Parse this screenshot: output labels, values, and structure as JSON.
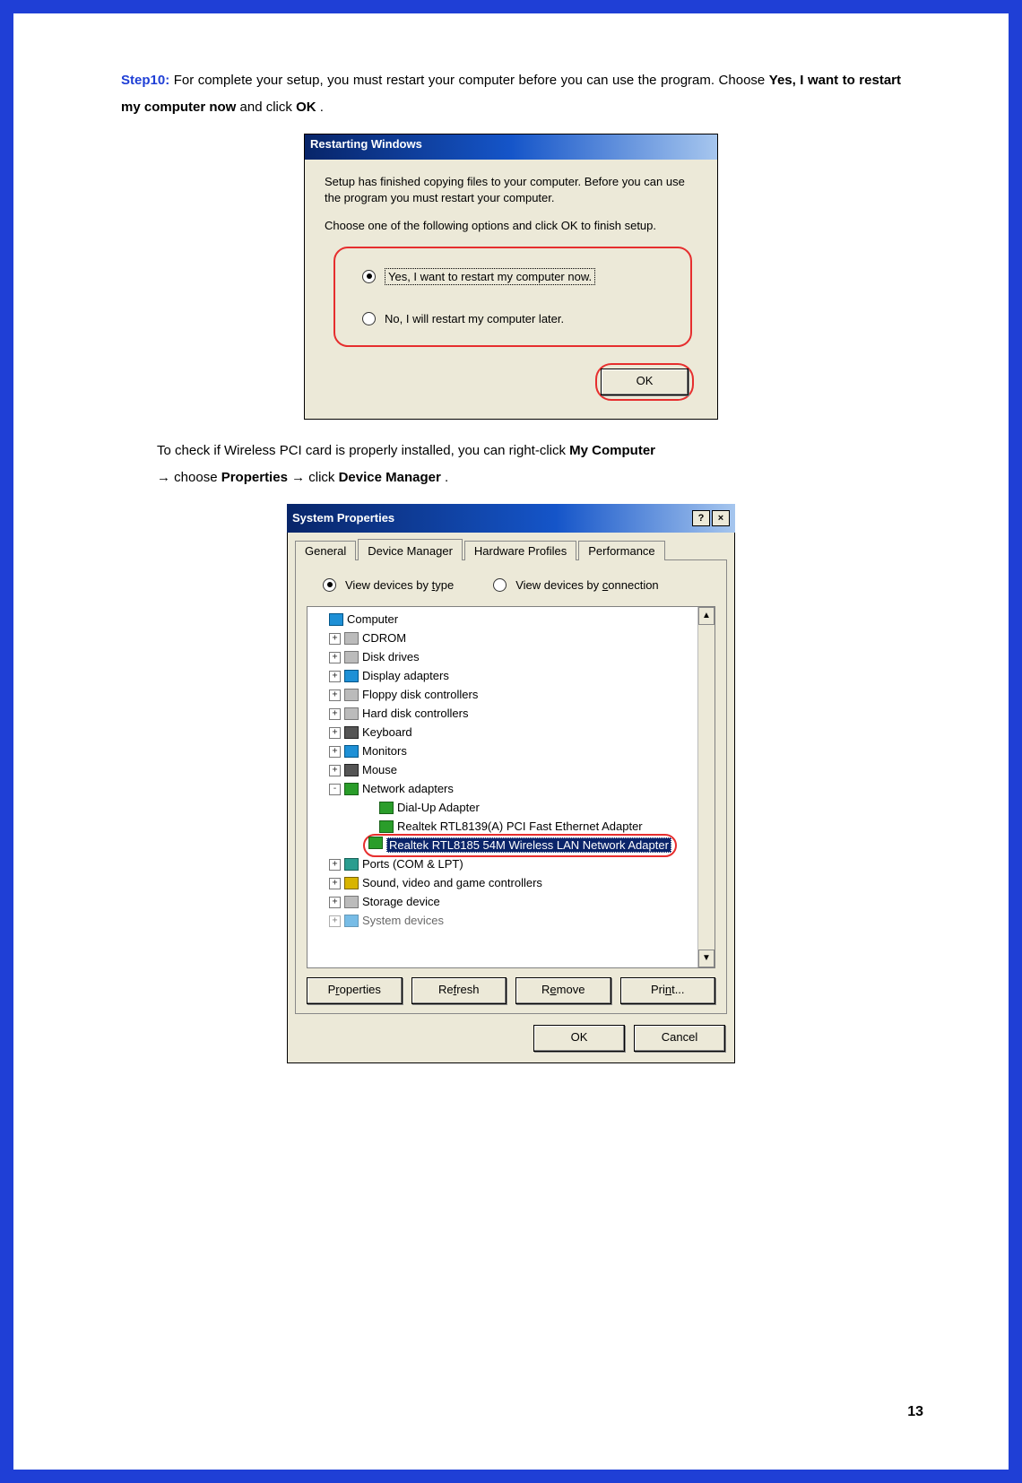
{
  "doc": {
    "step_label": "Step10:",
    "step_text_a": " For complete your setup, you must restart your computer before you can use the program. Choose ",
    "step_bold_1": "Yes, I want to restart my computer now",
    "step_text_b": " and click ",
    "step_bold_2": "OK",
    "step_text_c": ".",
    "check_a": "To check if Wireless PCI card is properly installed, you can right-click ",
    "check_b1": "My Computer",
    "arrow1": "→ choose ",
    "check_b2": "Properties",
    "arrow2": " → click ",
    "check_b3": "Device Manager",
    "check_end": ".",
    "page_num": "13"
  },
  "dlg1": {
    "title": "Restarting Windows",
    "hint1": "Setup has finished copying files to your computer.  Before you can use the program you must restart your computer.",
    "hint2": "Choose one of the following options and click OK to finish setup.",
    "opt_yes": "Yes, I want to restart my computer now.",
    "opt_no": "No, I will restart my computer later.",
    "ok": "OK"
  },
  "dlg2": {
    "title": "System Properties",
    "help_icon": "?",
    "close_icon": "×",
    "tabs": {
      "t1": "General",
      "t2": "Device Manager",
      "t3": "Hardware Profiles",
      "t4": "Performance"
    },
    "view_type": "View devices by type",
    "view_conn": "View devices by connection",
    "tree": {
      "root": "Computer",
      "n1": "CDROM",
      "n2": "Disk drives",
      "n3": "Display adapters",
      "n4": "Floppy disk controllers",
      "n5": "Hard disk controllers",
      "n6": "Keyboard",
      "n7": "Monitors",
      "n8": "Mouse",
      "n9": "Network adapters",
      "n9a": "Dial-Up Adapter",
      "n9b": "Realtek RTL8139(A) PCI Fast Ethernet Adapter",
      "n9c": "Realtek RTL8185 54M Wireless LAN Network Adapter",
      "n10": "Ports (COM & LPT)",
      "n11": "Sound, video and game controllers",
      "n12": "Storage device",
      "n13": "System devices"
    },
    "btn_props": "Properties",
    "btn_refresh": "Refresh",
    "btn_remove": "Remove",
    "btn_print": "Print...",
    "btn_ok": "OK",
    "btn_cancel": "Cancel",
    "scroll_up": "▲",
    "scroll_down": "▼"
  }
}
